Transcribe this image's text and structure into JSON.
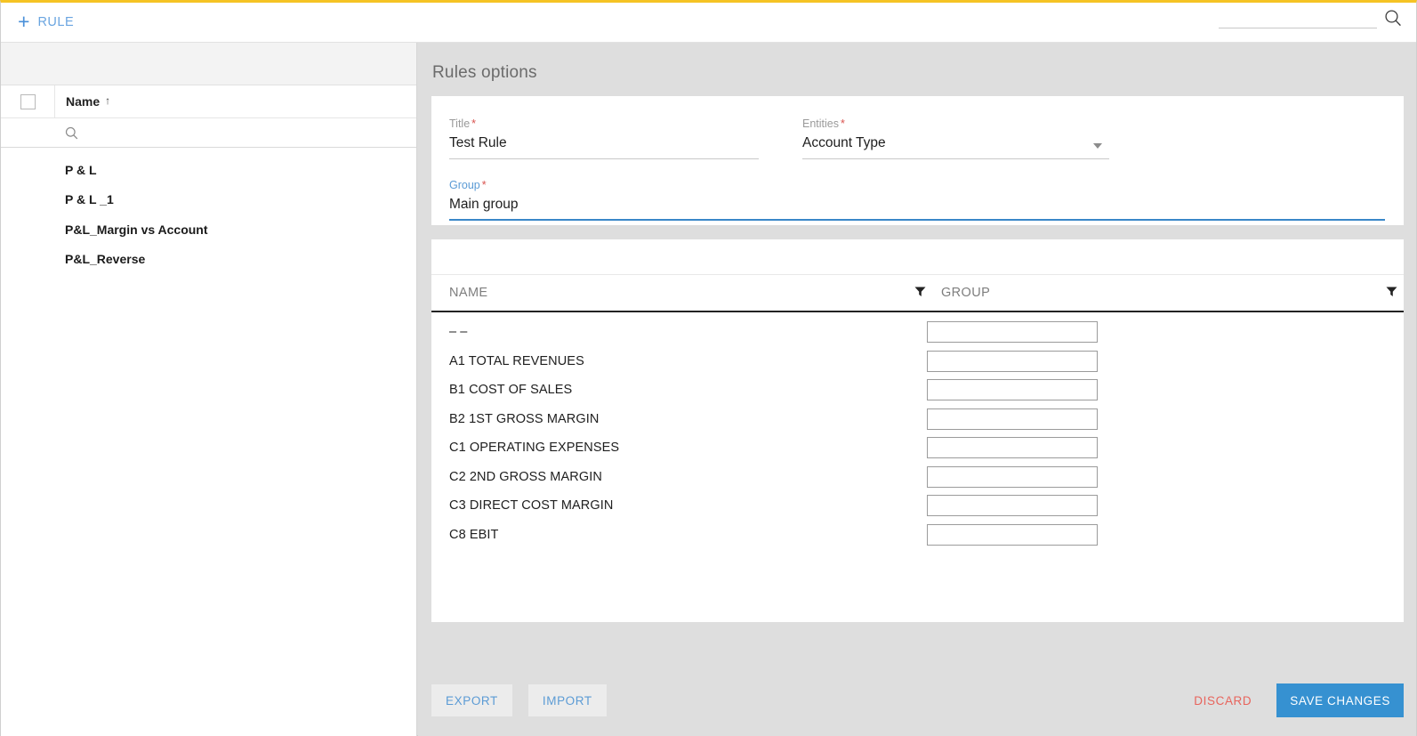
{
  "theme": {
    "accent_blue": "#3691d1",
    "link_blue": "#5b9bd5",
    "danger_red": "#e8645c",
    "top_border_yellow": "#f5c324",
    "panel_gray": "#dedede"
  },
  "topbar": {
    "add_rule_label": "RULE",
    "add_icon": "plus-icon",
    "search_icon": "search-icon",
    "search_value": "",
    "search_placeholder": ""
  },
  "sidebar": {
    "select_all_checkbox": "",
    "column_header": "Name",
    "sort_indicator": "↑",
    "search_icon": "search-icon",
    "search_value": "",
    "search_placeholder": "",
    "items": [
      {
        "label": "P & L"
      },
      {
        "label": "P & L _1"
      },
      {
        "label": "P&L_Margin vs Account"
      },
      {
        "label": "P&L_Reverse"
      }
    ]
  },
  "main": {
    "panel_title": "Rules options",
    "form": {
      "title_field": {
        "label": "Title",
        "required": "*",
        "value": "Test Rule",
        "placeholder": ""
      },
      "entities_field": {
        "label": "Entities",
        "required": "*",
        "value": "Account Type",
        "placeholder": "",
        "caret_icon": "chevron-down-icon"
      },
      "group_field": {
        "label": "Group",
        "required": "*",
        "value": "Main group",
        "placeholder": "",
        "focused": true
      }
    },
    "table": {
      "columns": [
        {
          "label": "NAME",
          "filter_icon": "filter-icon"
        },
        {
          "label": "GROUP",
          "filter_icon": "filter-icon"
        }
      ],
      "rows": [
        {
          "name": "– –",
          "group": ""
        },
        {
          "name": "A1 TOTAL REVENUES",
          "group": ""
        },
        {
          "name": "B1 COST OF SALES",
          "group": ""
        },
        {
          "name": "B2 1ST GROSS MARGIN",
          "group": ""
        },
        {
          "name": "C1 OPERATING EXPENSES",
          "group": ""
        },
        {
          "name": "C2 2ND GROSS MARGIN",
          "group": ""
        },
        {
          "name": "C3 DIRECT COST MARGIN",
          "group": ""
        },
        {
          "name": "C8 EBIT",
          "group": ""
        }
      ]
    },
    "footer": {
      "export_label": "EXPORT",
      "import_label": "IMPORT",
      "discard_label": "DISCARD",
      "save_label": "SAVE CHANGES"
    }
  }
}
